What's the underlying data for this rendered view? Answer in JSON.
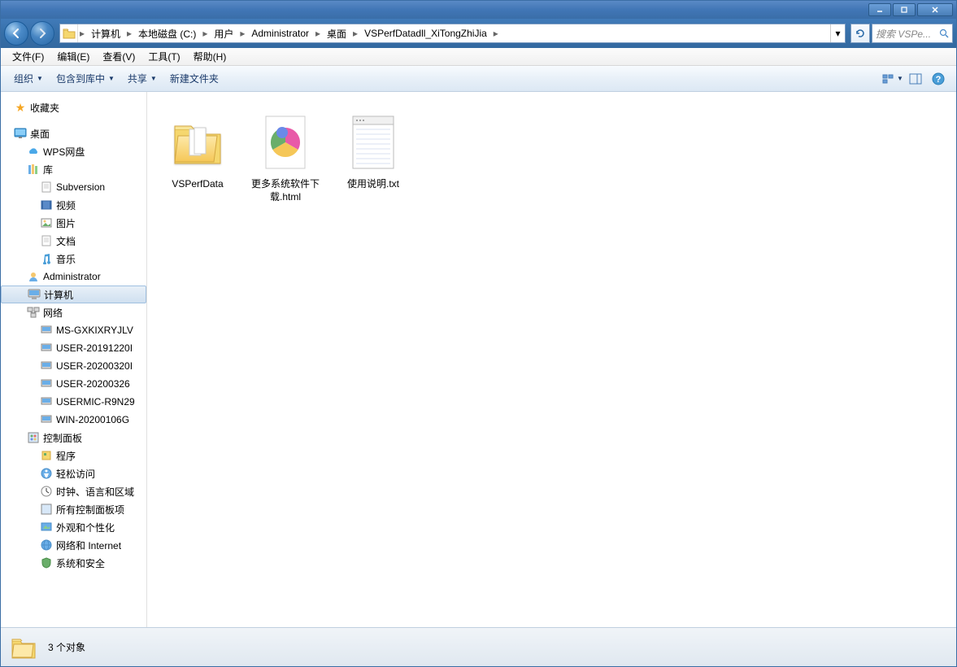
{
  "titlebar": {},
  "breadcrumb": {
    "items": [
      "计算机",
      "本地磁盘 (C:)",
      "用户",
      "Administrator",
      "桌面",
      "VSPerfDatadll_XiTongZhiJia"
    ]
  },
  "search": {
    "placeholder": "搜索 VSPe..."
  },
  "menu": {
    "file": "文件(F)",
    "edit": "编辑(E)",
    "view": "查看(V)",
    "tools": "工具(T)",
    "help": "帮助(H)"
  },
  "toolbar": {
    "organize": "组织",
    "include": "包含到库中",
    "share": "共享",
    "newfolder": "新建文件夹"
  },
  "sidebar": {
    "favorites": "收藏夹",
    "desktop": "桌面",
    "wps": "WPS网盘",
    "library": "库",
    "subversion": "Subversion",
    "video": "视频",
    "pictures": "图片",
    "documents": "文档",
    "music": "音乐",
    "admin": "Administrator",
    "computer": "计算机",
    "network": "网络",
    "net1": "MS-GXKIXRYJLV",
    "net2": "USER-20191220I",
    "net3": "USER-20200320I",
    "net4": "USER-20200326",
    "net5": "USERMIC-R9N29",
    "net6": "WIN-20200106G",
    "cpanel": "控制面板",
    "programs": "程序",
    "ease": "轻松访问",
    "clock": "时钟、语言和区域",
    "allcp": "所有控制面板项",
    "appearance": "外观和个性化",
    "netint": "网络和 Internet",
    "security": "系统和安全"
  },
  "files": {
    "f1": "VSPerfData",
    "f2": "更多系统软件下载.html",
    "f3": "使用说明.txt"
  },
  "status": {
    "count": "3 个对象"
  }
}
